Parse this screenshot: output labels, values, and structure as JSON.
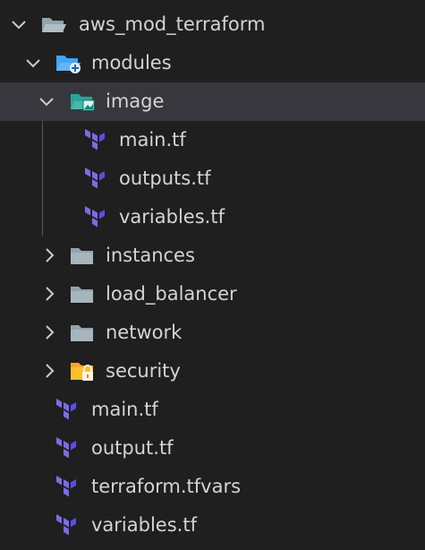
{
  "explorer": {
    "root": {
      "label": "aws_mod_terraform",
      "expanded": true
    },
    "modules": {
      "label": "modules",
      "expanded": true
    },
    "image": {
      "label": "image",
      "expanded": true,
      "selected": true
    },
    "image_files": [
      "main.tf",
      "outputs.tf",
      "variables.tf"
    ],
    "module_folders": [
      {
        "label": "instances",
        "icon": "folder-icon"
      },
      {
        "label": "load_balancer",
        "icon": "folder-icon"
      },
      {
        "label": "network",
        "icon": "folder-icon"
      },
      {
        "label": "security",
        "icon": "lock-folder-icon"
      }
    ],
    "root_files": [
      "main.tf",
      "output.tf",
      "terraform.tfvars",
      "variables.tf"
    ]
  },
  "colors": {
    "background": "#1f1f1f",
    "selected_row": "#37373d",
    "text": "#d4d4d4",
    "terraform": "#7b6ce6",
    "folder": "#90a4ae",
    "modules_folder": "#42a5f5",
    "image_folder": "#26a69a",
    "security_folder": "#f9a825"
  }
}
